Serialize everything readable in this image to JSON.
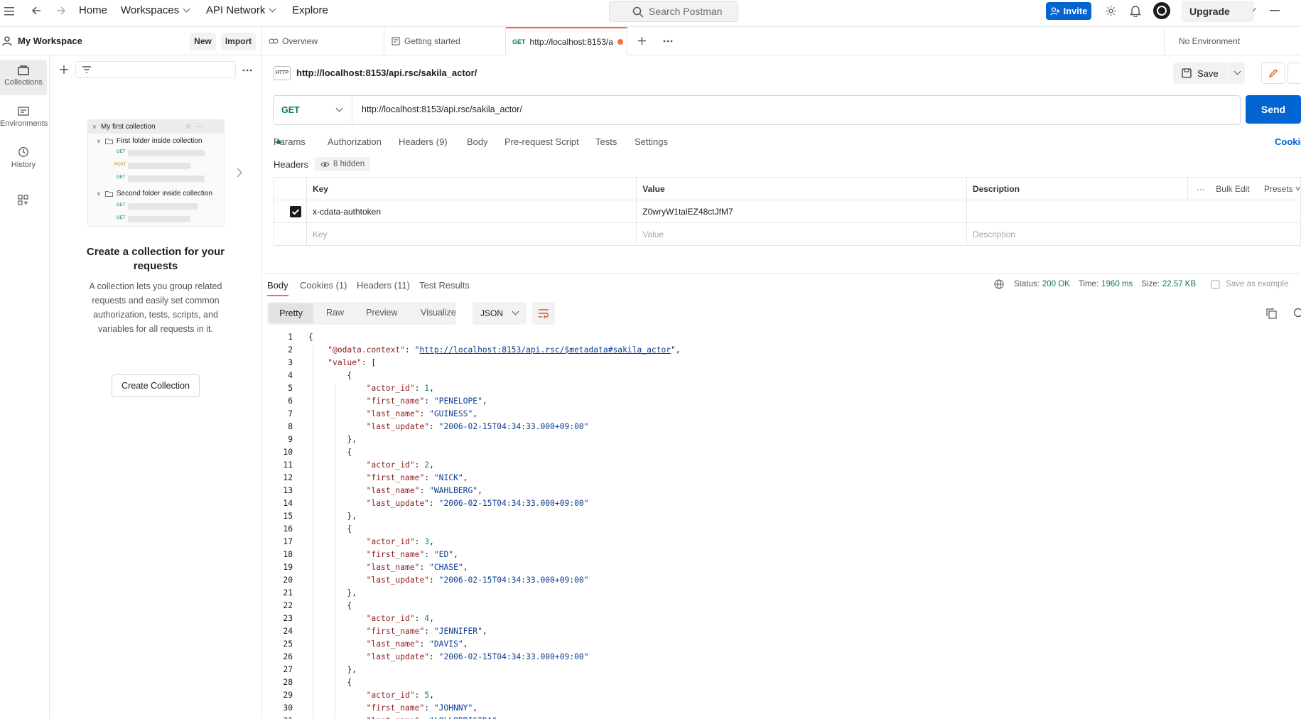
{
  "topbar": {
    "nav": [
      "Home",
      "Workspaces",
      "API Network",
      "Explore"
    ],
    "search_placeholder": "Search Postman",
    "invite": "Invite",
    "upgrade": "Upgrade"
  },
  "leftnav": {
    "items": [
      {
        "label": "Collections",
        "icon": "collections-icon"
      },
      {
        "label": "Environments",
        "icon": "environments-icon"
      },
      {
        "label": "History",
        "icon": "history-icon"
      },
      {
        "label": "",
        "icon": "apps-icon"
      }
    ]
  },
  "sidepanel": {
    "workspace": "My Workspace",
    "new": "New",
    "import": "Import",
    "illustration": {
      "collection": "My first collection",
      "folder1": "First folder inside collection",
      "folder2": "Second folder inside collection",
      "methods1": [
        "GET",
        "POST",
        "GET"
      ],
      "methods2": [
        "GET",
        "GET"
      ]
    },
    "empty_title": "Create a collection for your requests",
    "empty_body": "A collection lets you group related requests and easily set common authorization, tests, scripts, and variables for all requests in it.",
    "create_btn": "Create Collection"
  },
  "tabs": {
    "items": [
      "Overview",
      "Getting started"
    ],
    "active_method": "GET",
    "active_label": "http://localhost:8153/a",
    "environment": "No Environment"
  },
  "request": {
    "title": "http://localhost:8153/api.rsc/sakila_actor/",
    "method": "GET",
    "url": "http://localhost:8153/api.rsc/sakila_actor/",
    "send": "Send",
    "save": "Save",
    "cookies_link": "Cookies",
    "subtabs": [
      "Params",
      "Authorization",
      "Headers (9)",
      "Body",
      "Pre-request Script",
      "Tests",
      "Settings"
    ],
    "headers_label": "Headers",
    "hidden": "8 hidden",
    "columns": [
      "Key",
      "Value",
      "Description"
    ],
    "bulk_edit": "Bulk Edit",
    "presets": "Presets",
    "row": {
      "key": "x-cdata-authtoken",
      "value": "Z0wryW1talEZ48ctJfM7"
    },
    "placeholders": {
      "key": "Key",
      "value": "Value",
      "description": "Description"
    }
  },
  "response": {
    "tabs": [
      "Body",
      "Cookies (1)",
      "Headers (11)",
      "Test Results"
    ],
    "status_label": "Status:",
    "status": "200 OK",
    "time_label": "Time:",
    "time": "1960 ms",
    "size_label": "Size:",
    "size": "22.57 KB",
    "save_example": "Save as example",
    "views": [
      "Pretty",
      "Raw",
      "Preview",
      "Visualize"
    ],
    "format": "JSON",
    "context_url": "http://localhost:8153/api.rsc/$metadata#sakila_actor",
    "actors": [
      {
        "actor_id": 1,
        "first_name": "PENELOPE",
        "last_name": "GUINESS",
        "last_update": "2006-02-15T04:34:33.000+09:00"
      },
      {
        "actor_id": 2,
        "first_name": "NICK",
        "last_name": "WAHLBERG",
        "last_update": "2006-02-15T04:34:33.000+09:00"
      },
      {
        "actor_id": 3,
        "first_name": "ED",
        "last_name": "CHASE",
        "last_update": "2006-02-15T04:34:33.000+09:00"
      },
      {
        "actor_id": 4,
        "first_name": "JENNIFER",
        "last_name": "DAVIS",
        "last_update": "2006-02-15T04:34:33.000+09:00"
      },
      {
        "actor_id": 5,
        "first_name": "JOHNNY",
        "last_name": "LOLLOBRIGIDA",
        "last_update": ""
      }
    ],
    "line_count": 31
  },
  "colors": {
    "accent": "#ff6c37",
    "primary": "#0265d2",
    "status_ok": "#0a7d4b"
  }
}
